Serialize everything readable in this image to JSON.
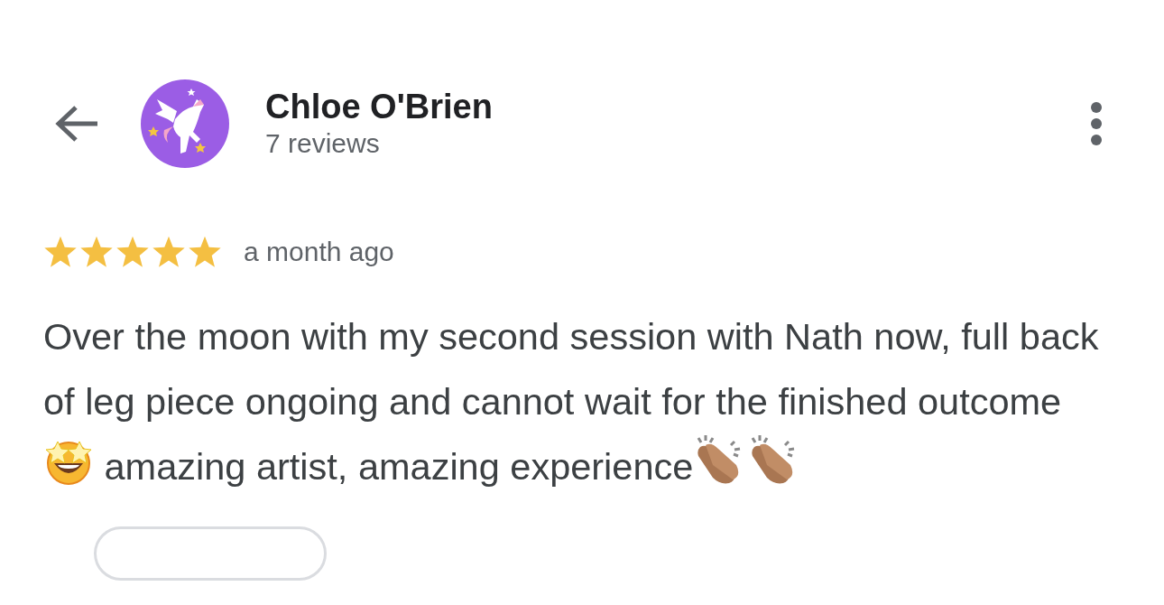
{
  "reviewer": {
    "name": "Chloe O'Brien",
    "review_count": "7 reviews"
  },
  "review": {
    "stars": 5,
    "time": "a month ago",
    "segments": [
      {
        "kind": "text",
        "text": "Over the moon with my second session with Nath now, full back of leg piece ongoing and cannot wait for the finished outcome"
      },
      {
        "kind": "star-eyes"
      },
      {
        "kind": "text",
        "text": " amazing artist, amazing experience"
      },
      {
        "kind": "clap"
      },
      {
        "kind": "clap"
      }
    ]
  }
}
